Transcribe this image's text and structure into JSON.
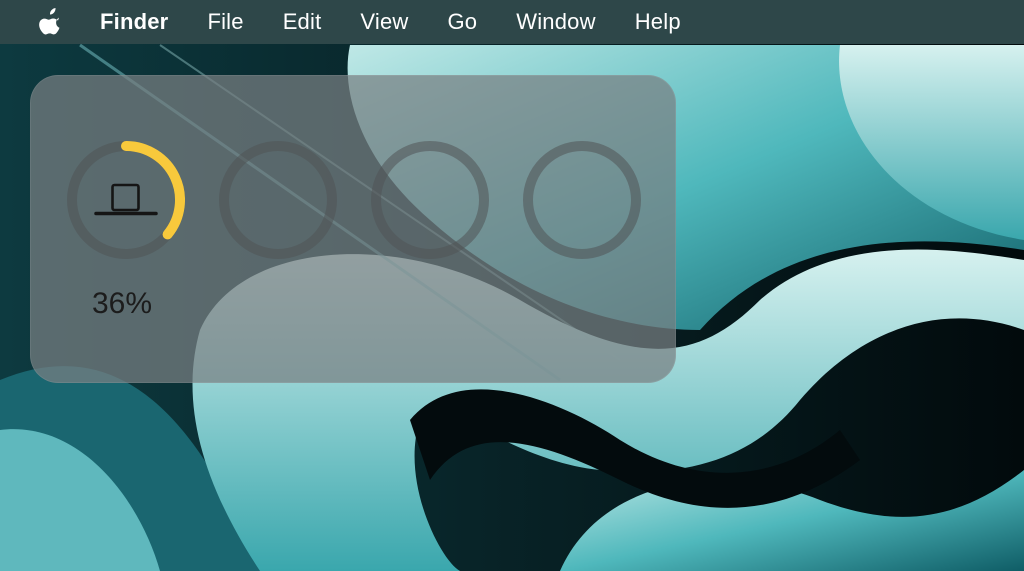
{
  "menubar": {
    "apple_icon": "apple-logo-icon",
    "app_name": "Finder",
    "items": [
      "File",
      "Edit",
      "View",
      "Go",
      "Window",
      "Help"
    ]
  },
  "battery_widget": {
    "devices": [
      {
        "icon": "laptop-icon",
        "percent": 36,
        "label": "36%",
        "ring_color": "#f8c93c"
      },
      {
        "icon": null,
        "percent": null
      },
      {
        "icon": null,
        "percent": null
      },
      {
        "icon": null,
        "percent": null
      }
    ]
  }
}
